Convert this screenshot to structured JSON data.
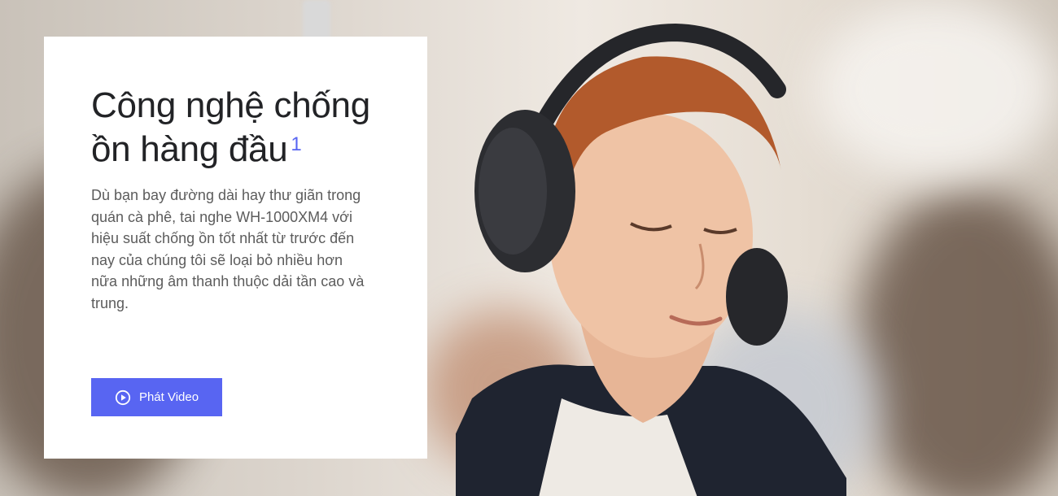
{
  "hero": {
    "headline": "Công nghệ chống ồn hàng đầu",
    "footnote_marker": "1",
    "description": "Dù bạn bay đường dài hay thư giãn trong quán cà phê, tai nghe WH-1000XM4 với hiệu suất chống ồn tốt nhất từ trước đến nay của chúng tôi sẽ loại bỏ nhiều hơn nữa những âm thanh thuộc dải tần cao và trung.",
    "play_button": {
      "label": "Phát Video",
      "icon": "play-circle-icon"
    }
  },
  "colors": {
    "accent": "#5865f2",
    "headline": "#222326",
    "body": "#5c5c5c",
    "card_bg": "#ffffff"
  }
}
